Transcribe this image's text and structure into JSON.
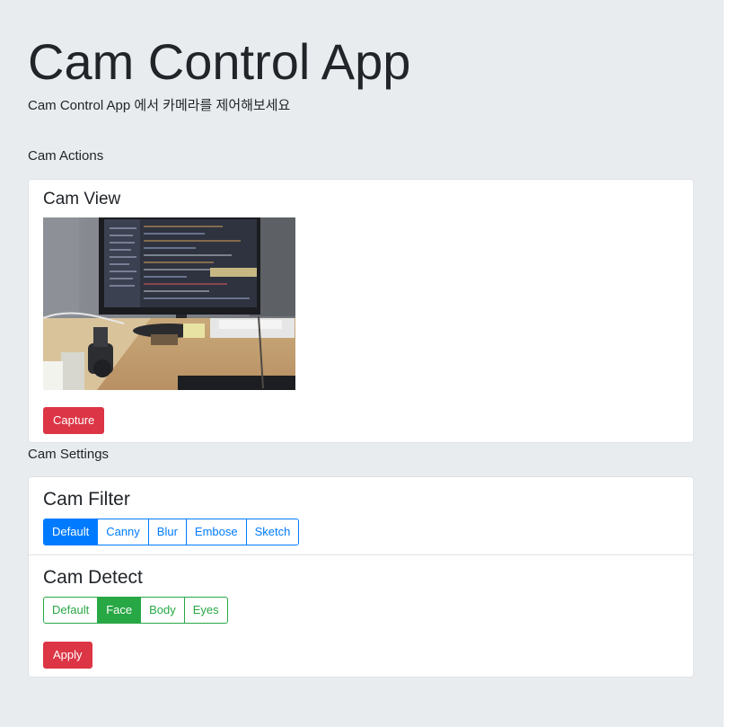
{
  "header": {
    "title": "Cam Control App",
    "subtitle": "Cam Control App 에서 카메라를 제어해보세요"
  },
  "actions": {
    "section_label": "Cam Actions",
    "view_title": "Cam View",
    "capture_label": "Capture"
  },
  "settings": {
    "section_label": "Cam Settings",
    "filter": {
      "title": "Cam Filter",
      "options": [
        "Default",
        "Canny",
        "Blur",
        "Embose",
        "Sketch"
      ],
      "selected": "Default"
    },
    "detect": {
      "title": "Cam Detect",
      "options": [
        "Default",
        "Face",
        "Body",
        "Eyes"
      ],
      "selected": "Face"
    },
    "apply_label": "Apply"
  },
  "colors": {
    "background": "#e9ecef",
    "primary": "#007bff",
    "success": "#28a745",
    "danger": "#dc3545"
  }
}
